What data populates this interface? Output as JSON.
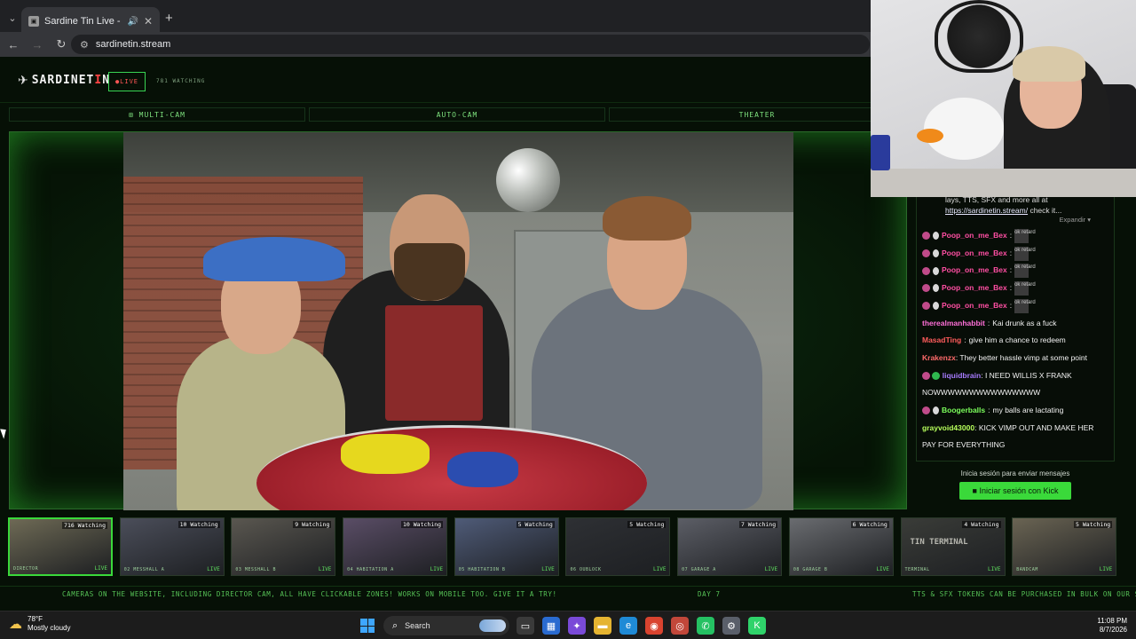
{
  "browser": {
    "tab_title": "Sardine Tin Live - All Rooms",
    "url": "sardinetin.stream",
    "colors": {
      "chrome_dark": "#202124",
      "chrome_light": "#35363a"
    }
  },
  "site": {
    "logo_prefix": "SARDINET",
    "logo_mark": "I",
    "logo_suffix": "N",
    "live_label": "●LIVE",
    "watching": "781 WATCHING",
    "views": [
      "⊞ MULTI-CAM",
      "AUTO-CAM",
      "THEATER"
    ],
    "accent": "#3ad93a"
  },
  "chat": {
    "pinned_text": "lays, TTS, SFX and more all at",
    "pinned_link": "https://sardinetin.stream/",
    "pinned_tail": "check it...",
    "expand": "Expandir ▾",
    "messages": [
      {
        "user": "Poop_on_me_Bex",
        "color": "#ff4fa3",
        "text": "",
        "emote": "ok retard",
        "badges": [
          "sub",
          "w"
        ]
      },
      {
        "user": "Poop_on_me_Bex",
        "color": "#ff4fa3",
        "text": "",
        "emote": "ok retard",
        "badges": [
          "sub",
          "w"
        ]
      },
      {
        "user": "Poop_on_me_Bex",
        "color": "#ff4fa3",
        "text": "",
        "emote": "ok retard",
        "badges": [
          "sub",
          "w"
        ]
      },
      {
        "user": "Poop_on_me_Bex",
        "color": "#ff4fa3",
        "text": "",
        "emote": "ok retard",
        "badges": [
          "sub",
          "w"
        ]
      },
      {
        "user": "Poop_on_me_Bex",
        "color": "#ff4fa3",
        "text": "",
        "emote": "ok retard",
        "badges": [
          "sub",
          "w"
        ]
      },
      {
        "user": "therealmanhabbit",
        "color": "#ff6fd8",
        "text": "Kai drunk as a fuck",
        "emote": "",
        "badges": []
      },
      {
        "user": "MasadTing",
        "color": "#ff5c5c",
        "text": "give him a chance to redeem",
        "emote": "",
        "badges": []
      },
      {
        "user": "Krakenzx",
        "color": "#ff6b6b",
        "text": "They better hassle vimp at some point",
        "emote": "",
        "badges": []
      },
      {
        "user": "liquidbrain",
        "color": "#a77bff",
        "text": "I NEED WILLIS X FRANK NOWWWWWWWWWWWWWWW",
        "emote": "",
        "badges": [
          "sub",
          "g"
        ]
      },
      {
        "user": "Boogerballs",
        "color": "#7cff5c",
        "text": "my balls are lactating",
        "emote": "",
        "badges": [
          "sub",
          "w"
        ]
      },
      {
        "user": "grayvoid43000",
        "color": "#b7ff5c",
        "text": "KICK VIMP OUT AND MAKE HER PAY FOR EVERYTHING",
        "emote": "",
        "badges": []
      }
    ],
    "login_hint": "Inicia sesión para enviar mensajes",
    "login_button": "Iniciar sesión con Kick"
  },
  "cams": [
    {
      "name": "DIRECTOR",
      "watching": "716 Watching",
      "live": "LIVE",
      "bg": "#6e6a55"
    },
    {
      "name": "02 MESSHALL A",
      "watching": "10 Watching",
      "live": "LIVE",
      "bg": "#4b4e5a"
    },
    {
      "name": "03 MESSHALL B",
      "watching": "9 Watching",
      "live": "LIVE",
      "bg": "#5a5750"
    },
    {
      "name": "04 HABITATION A",
      "watching": "10 Watching",
      "live": "LIVE",
      "bg": "#5a4d66"
    },
    {
      "name": "05 HABITATION B",
      "watching": "5 Watching",
      "live": "LIVE",
      "bg": "#4f5b78"
    },
    {
      "name": "06 OUBLOCK",
      "watching": "5 Watching",
      "live": "LIVE",
      "bg": "#2e3034"
    },
    {
      "name": "07 GARAGE A",
      "watching": "7 Watching",
      "live": "LIVE",
      "bg": "#5c5e66"
    },
    {
      "name": "08 GARAGE B",
      "watching": "6 Watching",
      "live": "LIVE",
      "bg": "#6a6c70"
    },
    {
      "name": "TERMINAL",
      "watching": "4 Watching",
      "live": "LIVE",
      "bg": "#3a3c38",
      "overlay": "TIN TERMINAL"
    },
    {
      "name": "BANDCAM",
      "watching": "5 Watching",
      "live": "LIVE",
      "bg": "#6a6453"
    }
  ],
  "ticker": {
    "left": "CAMERAS ON THE WEBSITE, INCLUDING DIRECTOR CAM, ALL HAVE CLICKABLE ZONES! WORKS ON MOBILE TOO. GIVE IT A TRY!",
    "center": "DAY 7",
    "right": "TTS & SFX TOKENS CAN BE PURCHASED IN BULK ON OUR S"
  },
  "taskbar": {
    "weather_temp": "78°F",
    "weather_desc": "Mostly cloudy",
    "search": "Search",
    "time": "11:08 PM",
    "date": "8/7/2026"
  }
}
